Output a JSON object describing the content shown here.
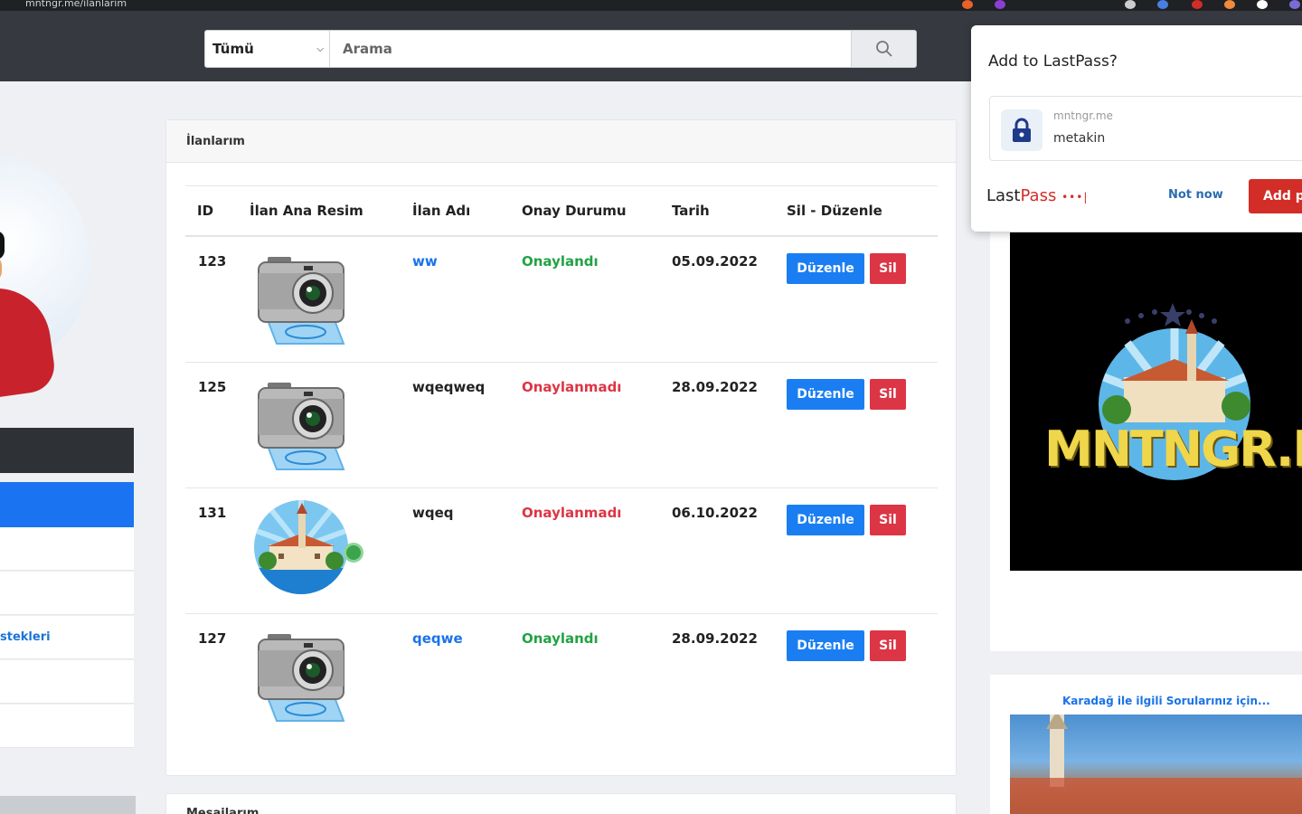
{
  "browser": {
    "url_text": "mntngr.me/ilanlarim"
  },
  "search": {
    "category_selected": "Tümü",
    "placeholder": "Arama"
  },
  "sidebar": {
    "items": [
      {
        "label": ""
      },
      {
        "label": ""
      },
      {
        "label": "stekleri"
      },
      {
        "label": ""
      },
      {
        "label": ""
      }
    ]
  },
  "listings_card": {
    "title": "İlanlarım",
    "columns": [
      "ID",
      "İlan Ana Resim",
      "İlan Adı",
      "Onay Durumu",
      "Tarih",
      "Sil - Düzenle"
    ],
    "rows": [
      {
        "id": "123",
        "image": "camera-icon",
        "name": "ww",
        "name_is_link": true,
        "status": "Onaylandı",
        "status_color": "#23a244",
        "date": "05.09.2022",
        "edit_label": "Düzenle",
        "delete_label": "Sil"
      },
      {
        "id": "125",
        "image": "camera-icon",
        "name": "wqeqweq",
        "name_is_link": false,
        "status": "Onaylanmadı",
        "status_color": "#dc3545",
        "date": "28.09.2022",
        "edit_label": "Düzenle",
        "delete_label": "Sil"
      },
      {
        "id": "131",
        "image": "town-logo-image",
        "name": "wqeq",
        "name_is_link": false,
        "status": "Onaylanmadı",
        "status_color": "#dc3545",
        "date": "06.10.2022",
        "edit_label": "Düzenle",
        "delete_label": "Sil"
      },
      {
        "id": "127",
        "image": "camera-icon",
        "name": "qeqwe",
        "name_is_link": true,
        "status": "Onaylandı",
        "status_color": "#23a244",
        "date": "28.09.2022",
        "edit_label": "Düzenle",
        "delete_label": "Sil"
      }
    ]
  },
  "second_card": {
    "title": "Mesajlarım"
  },
  "right_ad": {
    "brand_text": "MNTNGR.ME"
  },
  "right_card2": {
    "title": "Karadağ ile ilgili Sorularınız için..."
  },
  "lastpass": {
    "title": "Add to LastPass?",
    "site": "mntngr.me",
    "username": "metakin",
    "logo_last": "Last",
    "logo_pass": "Pass",
    "logo_dots": "•••|",
    "not_now": "Not now",
    "add_label": "Add p"
  },
  "colors": {
    "accent_blue": "#1a7ef2",
    "danger_red": "#dc3545",
    "success_green": "#23a244",
    "header_dark": "#363a40",
    "lastpass_red": "#d32d27"
  }
}
